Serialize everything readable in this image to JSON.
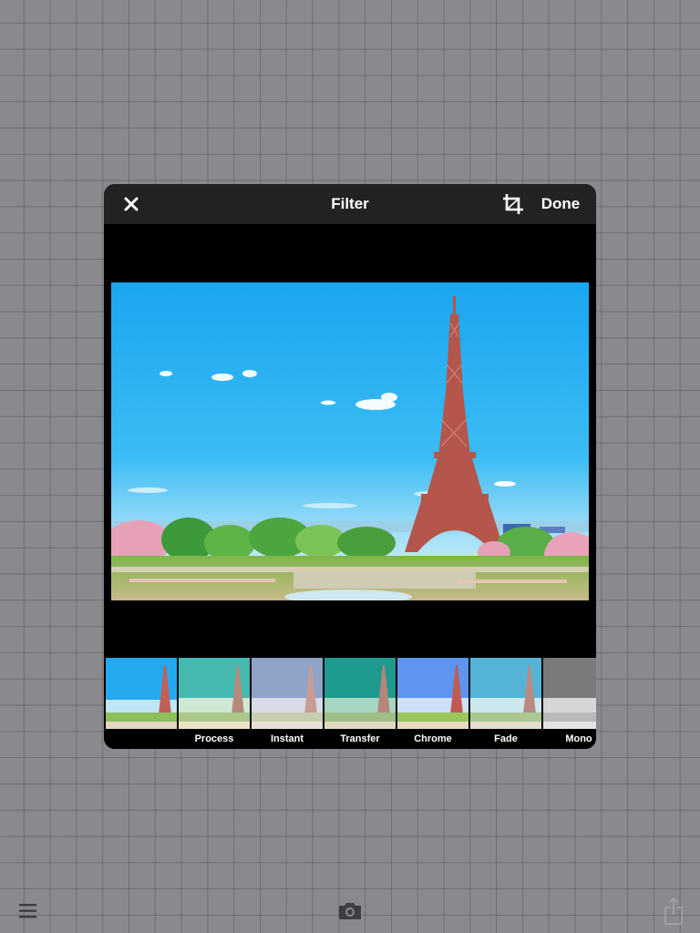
{
  "modal": {
    "title": "Filter",
    "done_label": "Done",
    "icons": {
      "close": "close-icon",
      "crop": "crop-icon"
    }
  },
  "photo": {
    "subject": "eiffel-tower-photo"
  },
  "filters": [
    {
      "label": "",
      "tint": "none"
    },
    {
      "label": "Process",
      "tint": "teal"
    },
    {
      "label": "Instant",
      "tint": "faded"
    },
    {
      "label": "Transfer",
      "tint": "green-teal"
    },
    {
      "label": "Chrome",
      "tint": "vivid"
    },
    {
      "label": "Fade",
      "tint": "soft"
    },
    {
      "label": "Mono",
      "tint": "grayscale"
    }
  ],
  "toolbar": {
    "icons": {
      "menu": "menu-icon",
      "camera": "camera-icon",
      "share": "share-icon"
    }
  },
  "colors": {
    "header_bg": "#222223",
    "sky_top": "#1ea8f0",
    "sky_bottom": "#9fdcf6",
    "tower": "#b5544a",
    "background": "#8a8a8e"
  }
}
